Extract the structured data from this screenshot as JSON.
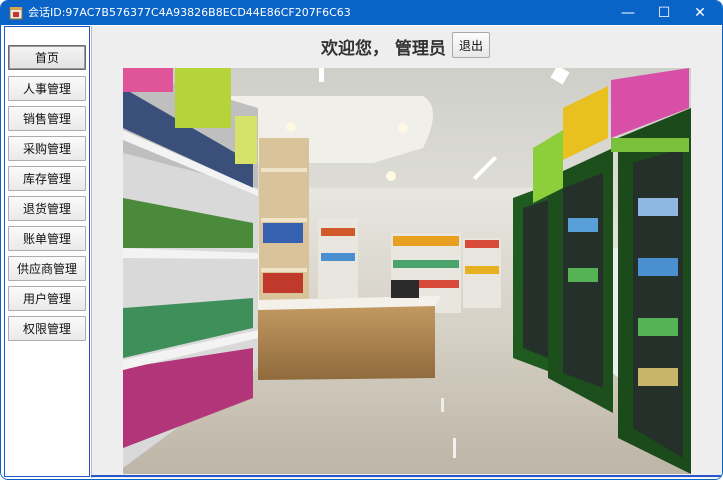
{
  "window": {
    "title": "会话ID:97AC7B576377C4A93826B8ECD44E86CF207F6C63",
    "minimize_glyph": "—",
    "maximize_glyph": "☐",
    "close_glyph": "✕"
  },
  "sidebar": {
    "items": [
      {
        "label": "首页"
      },
      {
        "label": "人事管理"
      },
      {
        "label": "销售管理"
      },
      {
        "label": "采购管理"
      },
      {
        "label": "库存管理"
      },
      {
        "label": "退货管理"
      },
      {
        "label": "账单管理"
      },
      {
        "label": "供应商管理"
      },
      {
        "label": "用户管理"
      },
      {
        "label": "权限管理"
      }
    ],
    "active": "首页"
  },
  "header": {
    "welcome": "欢迎您， 管理员",
    "logout_label": "退出"
  },
  "colors": {
    "titlebar": "#0a64c8",
    "accent_border": "#2255cc"
  },
  "icons": [
    "app-icon",
    "minimize-icon",
    "maximize-icon",
    "close-icon"
  ]
}
